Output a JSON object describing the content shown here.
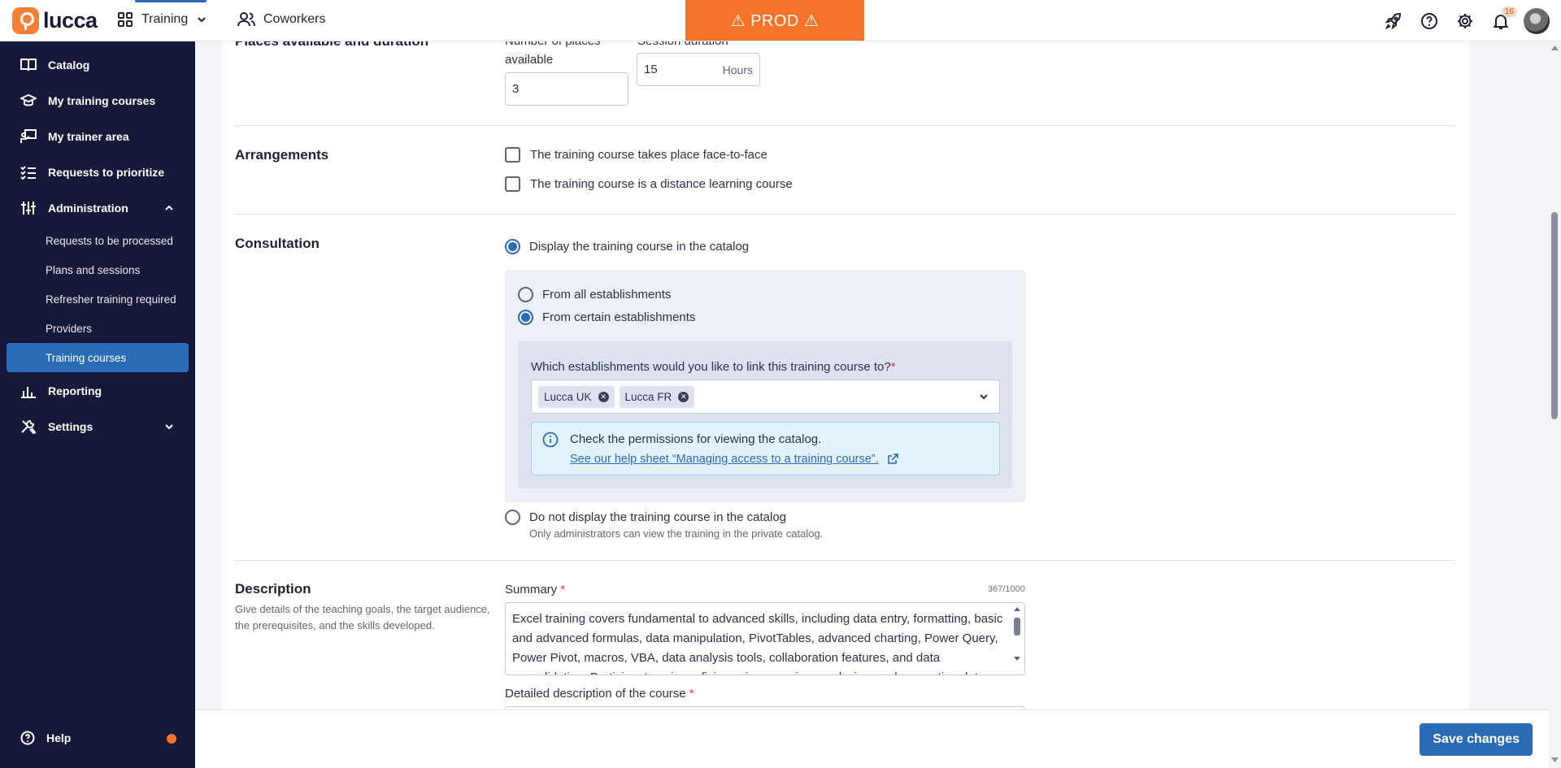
{
  "header": {
    "logo_text": "lucca",
    "app_name": "Training",
    "coworkers_label": "Coworkers",
    "env_banner": "⚠ PROD ⚠",
    "notification_count": "16"
  },
  "sidebar": {
    "items": [
      {
        "label": "Catalog",
        "icon": "catalog-icon"
      },
      {
        "label": "My training courses",
        "icon": "graduation-cap-icon"
      },
      {
        "label": "My trainer area",
        "icon": "trainer-board-icon"
      },
      {
        "label": "Requests to prioritize",
        "icon": "list-check-icon"
      },
      {
        "label": "Administration",
        "icon": "sliders-icon",
        "expanded": true
      }
    ],
    "admin_subitems": [
      {
        "label": "Requests to be processed"
      },
      {
        "label": "Plans and sessions"
      },
      {
        "label": "Refresher training required"
      },
      {
        "label": "Providers"
      },
      {
        "label": "Training courses",
        "active": true
      }
    ],
    "bottom_items": [
      {
        "label": "Reporting",
        "icon": "bar-chart-icon"
      },
      {
        "label": "Settings",
        "icon": "tools-icon"
      }
    ],
    "help_label": "Help"
  },
  "places": {
    "title": "Places available and duration",
    "places_label_line1": "Number of places",
    "places_label_line2": "available",
    "places_value": "3",
    "duration_label": "Session duration",
    "duration_value": "15",
    "duration_unit": "Hours"
  },
  "arrangements": {
    "title": "Arrangements",
    "face_to_face": "The training course takes place face-to-face",
    "distance": "The training course is a distance learning course"
  },
  "consultation": {
    "title": "Consultation",
    "display_in_catalog": "Display the training course in the catalog",
    "from_all": "From all establishments",
    "from_certain": "From certain establishments",
    "establishments_question": "Which establishments would you like to link this training course to?",
    "required_mark": "*",
    "selected_establishments": [
      "Lucca UK",
      "Lucca FR"
    ],
    "callout_title": "Check the permissions for viewing the catalog.",
    "callout_link": "See our help sheet “Managing access to a training course”.",
    "do_not_display": "Do not display the training course in the catalog",
    "do_not_display_hint": "Only administrators can view the training in the private catalog."
  },
  "description": {
    "title": "Description",
    "help_text": "Give details of the teaching goals, the target audience, the prerequisites, and the skills developed.",
    "summary_label": "Summary",
    "required_mark": "*",
    "counter": "367/1000",
    "summary_text": "Excel training covers fundamental to advanced skills, including data entry, formatting, basic and advanced formulas, data manipulation, PivotTables, advanced charting, Power Query, Power Pivot, macros, VBA, data analysis tools, collaboration features, and data consolidation. Participants gain proficiency in managing, analyzing, and presenting data.",
    "detailed_label": "Detailed description of the course"
  },
  "footer": {
    "save_label": "Save changes"
  }
}
